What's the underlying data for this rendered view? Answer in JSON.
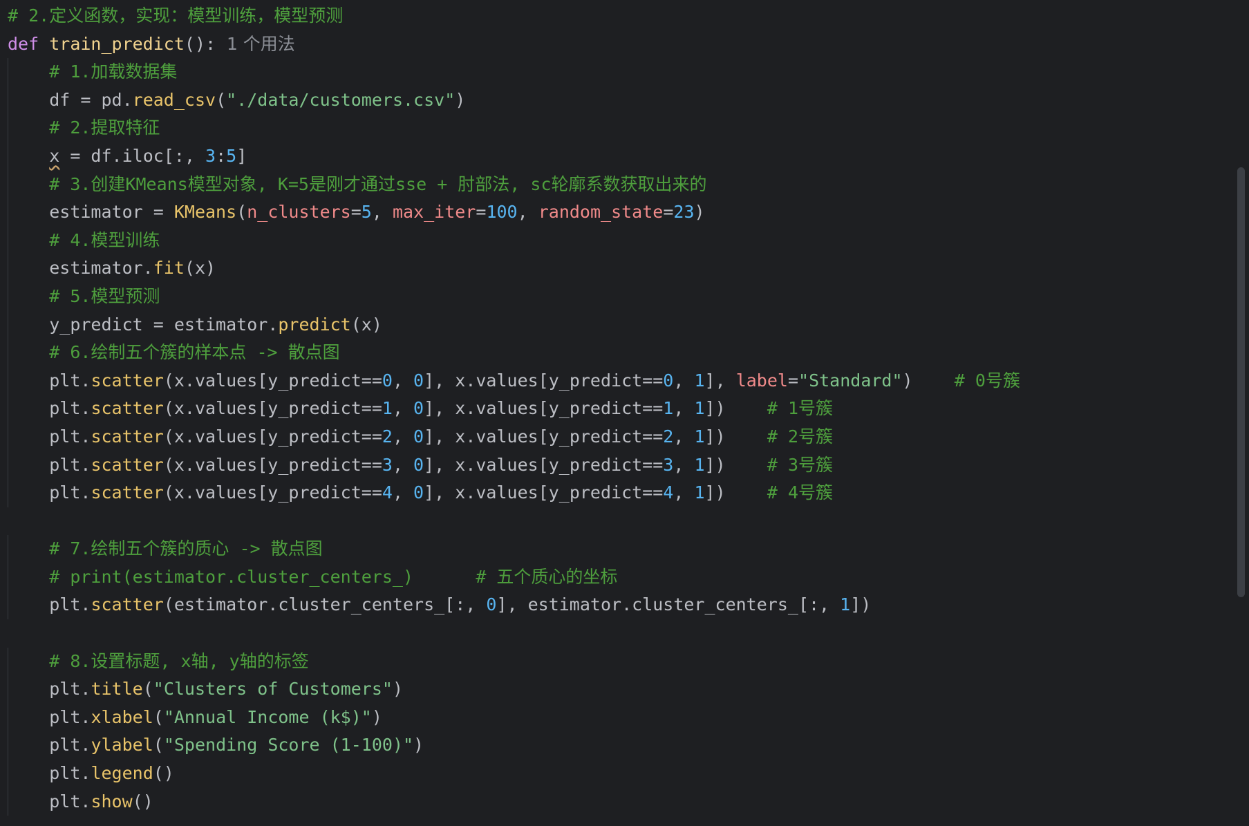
{
  "colors": {
    "background": "#1e1f22",
    "plain": "#bcbec4",
    "keyword": "#cf8ee8",
    "function_def": "#f0d28f",
    "call": "#e9c46a",
    "string": "#7fc28a",
    "number": "#58b4f0",
    "comment": "#4e9f3d",
    "param": "#f08a8a",
    "hint": "#8c8f96",
    "indent_guide": "#393b40",
    "scrollbar_thumb": "#3c3f45"
  },
  "lines": [
    {
      "indent": 0,
      "tokens": [
        {
          "t": "# 2.定义函数，实现：模型训练，模型预测",
          "c": "comment"
        }
      ]
    },
    {
      "indent": 0,
      "tokens": [
        {
          "t": "def",
          "c": "keyword"
        },
        {
          "t": " ",
          "c": "plain"
        },
        {
          "t": "train_predict",
          "c": "function_def"
        },
        {
          "t": "():",
          "c": "plain"
        },
        {
          "t": "  1 个用法",
          "c": "hint",
          "f": "sans"
        }
      ]
    },
    {
      "indent": 4,
      "tokens": [
        {
          "t": "# 1.加载数据集",
          "c": "comment"
        }
      ]
    },
    {
      "indent": 4,
      "tokens": [
        {
          "t": "df = pd.",
          "c": "plain"
        },
        {
          "t": "read_csv",
          "c": "call"
        },
        {
          "t": "(",
          "c": "plain"
        },
        {
          "t": "\"./data/customers.csv\"",
          "c": "string"
        },
        {
          "t": ")",
          "c": "plain"
        }
      ]
    },
    {
      "indent": 4,
      "tokens": [
        {
          "t": "# 2.提取特征",
          "c": "comment"
        }
      ]
    },
    {
      "indent": 4,
      "tokens": [
        {
          "t": "x",
          "c": "plain",
          "sq": true
        },
        {
          "t": " = df.iloc[:, ",
          "c": "plain"
        },
        {
          "t": "3",
          "c": "number"
        },
        {
          "t": ":",
          "c": "plain"
        },
        {
          "t": "5",
          "c": "number"
        },
        {
          "t": "]",
          "c": "plain"
        }
      ]
    },
    {
      "indent": 4,
      "tokens": [
        {
          "t": "# 3.创建KMeans模型对象, K=5是刚才通过sse + 肘部法, sc轮廓系数获取出来的",
          "c": "comment"
        }
      ]
    },
    {
      "indent": 4,
      "tokens": [
        {
          "t": "estimator = ",
          "c": "plain"
        },
        {
          "t": "KMeans",
          "c": "call"
        },
        {
          "t": "(",
          "c": "plain"
        },
        {
          "t": "n_clusters",
          "c": "param"
        },
        {
          "t": "=",
          "c": "plain"
        },
        {
          "t": "5",
          "c": "number"
        },
        {
          "t": ", ",
          "c": "plain"
        },
        {
          "t": "max_iter",
          "c": "param"
        },
        {
          "t": "=",
          "c": "plain"
        },
        {
          "t": "100",
          "c": "number"
        },
        {
          "t": ", ",
          "c": "plain"
        },
        {
          "t": "random_state",
          "c": "param"
        },
        {
          "t": "=",
          "c": "plain"
        },
        {
          "t": "23",
          "c": "number"
        },
        {
          "t": ")",
          "c": "plain"
        }
      ]
    },
    {
      "indent": 4,
      "tokens": [
        {
          "t": "# 4.模型训练",
          "c": "comment"
        }
      ]
    },
    {
      "indent": 4,
      "tokens": [
        {
          "t": "estimator.",
          "c": "plain"
        },
        {
          "t": "fit",
          "c": "call"
        },
        {
          "t": "(x)",
          "c": "plain"
        }
      ]
    },
    {
      "indent": 4,
      "tokens": [
        {
          "t": "# 5.模型预测",
          "c": "comment"
        }
      ]
    },
    {
      "indent": 4,
      "tokens": [
        {
          "t": "y_predict = estimator.",
          "c": "plain"
        },
        {
          "t": "predict",
          "c": "call"
        },
        {
          "t": "(x)",
          "c": "plain"
        }
      ]
    },
    {
      "indent": 4,
      "tokens": [
        {
          "t": "# 6.绘制五个簇的样本点 -> 散点图",
          "c": "comment"
        }
      ]
    },
    {
      "indent": 4,
      "tokens": [
        {
          "t": "plt.",
          "c": "plain"
        },
        {
          "t": "scatter",
          "c": "call"
        },
        {
          "t": "(x.values[y_predict==",
          "c": "plain"
        },
        {
          "t": "0",
          "c": "number"
        },
        {
          "t": ", ",
          "c": "plain"
        },
        {
          "t": "0",
          "c": "number"
        },
        {
          "t": "], x.values[y_predict==",
          "c": "plain"
        },
        {
          "t": "0",
          "c": "number"
        },
        {
          "t": ", ",
          "c": "plain"
        },
        {
          "t": "1",
          "c": "number"
        },
        {
          "t": "], ",
          "c": "plain"
        },
        {
          "t": "label",
          "c": "param"
        },
        {
          "t": "=",
          "c": "plain"
        },
        {
          "t": "\"Standard\"",
          "c": "string"
        },
        {
          "t": ")    ",
          "c": "plain"
        },
        {
          "t": "# 0号簇",
          "c": "comment"
        }
      ]
    },
    {
      "indent": 4,
      "tokens": [
        {
          "t": "plt.",
          "c": "plain"
        },
        {
          "t": "scatter",
          "c": "call"
        },
        {
          "t": "(x.values[y_predict==",
          "c": "plain"
        },
        {
          "t": "1",
          "c": "number"
        },
        {
          "t": ", ",
          "c": "plain"
        },
        {
          "t": "0",
          "c": "number"
        },
        {
          "t": "], x.values[y_predict==",
          "c": "plain"
        },
        {
          "t": "1",
          "c": "number"
        },
        {
          "t": ", ",
          "c": "plain"
        },
        {
          "t": "1",
          "c": "number"
        },
        {
          "t": "])    ",
          "c": "plain"
        },
        {
          "t": "# 1号簇",
          "c": "comment"
        }
      ]
    },
    {
      "indent": 4,
      "tokens": [
        {
          "t": "plt.",
          "c": "plain"
        },
        {
          "t": "scatter",
          "c": "call"
        },
        {
          "t": "(x.values[y_predict==",
          "c": "plain"
        },
        {
          "t": "2",
          "c": "number"
        },
        {
          "t": ", ",
          "c": "plain"
        },
        {
          "t": "0",
          "c": "number"
        },
        {
          "t": "], x.values[y_predict==",
          "c": "plain"
        },
        {
          "t": "2",
          "c": "number"
        },
        {
          "t": ", ",
          "c": "plain"
        },
        {
          "t": "1",
          "c": "number"
        },
        {
          "t": "])    ",
          "c": "plain"
        },
        {
          "t": "# 2号簇",
          "c": "comment"
        }
      ]
    },
    {
      "indent": 4,
      "tokens": [
        {
          "t": "plt.",
          "c": "plain"
        },
        {
          "t": "scatter",
          "c": "call"
        },
        {
          "t": "(x.values[y_predict==",
          "c": "plain"
        },
        {
          "t": "3",
          "c": "number"
        },
        {
          "t": ", ",
          "c": "plain"
        },
        {
          "t": "0",
          "c": "number"
        },
        {
          "t": "], x.values[y_predict==",
          "c": "plain"
        },
        {
          "t": "3",
          "c": "number"
        },
        {
          "t": ", ",
          "c": "plain"
        },
        {
          "t": "1",
          "c": "number"
        },
        {
          "t": "])    ",
          "c": "plain"
        },
        {
          "t": "# 3号簇",
          "c": "comment"
        }
      ]
    },
    {
      "indent": 4,
      "tokens": [
        {
          "t": "plt.",
          "c": "plain"
        },
        {
          "t": "scatter",
          "c": "call"
        },
        {
          "t": "(x.values[y_predict==",
          "c": "plain"
        },
        {
          "t": "4",
          "c": "number"
        },
        {
          "t": ", ",
          "c": "plain"
        },
        {
          "t": "0",
          "c": "number"
        },
        {
          "t": "], x.values[y_predict==",
          "c": "plain"
        },
        {
          "t": "4",
          "c": "number"
        },
        {
          "t": ", ",
          "c": "plain"
        },
        {
          "t": "1",
          "c": "number"
        },
        {
          "t": "])    ",
          "c": "plain"
        },
        {
          "t": "# 4号簇",
          "c": "comment"
        }
      ]
    },
    {
      "indent": 0,
      "tokens": []
    },
    {
      "indent": 4,
      "tokens": [
        {
          "t": "# 7.绘制五个簇的质心 -> 散点图",
          "c": "comment"
        }
      ]
    },
    {
      "indent": 4,
      "tokens": [
        {
          "t": "# print(estimator.cluster_centers_)      # 五个质心的坐标",
          "c": "comment"
        }
      ]
    },
    {
      "indent": 4,
      "tokens": [
        {
          "t": "plt.",
          "c": "plain"
        },
        {
          "t": "scatter",
          "c": "call"
        },
        {
          "t": "(estimator.cluster_centers_[:, ",
          "c": "plain"
        },
        {
          "t": "0",
          "c": "number"
        },
        {
          "t": "], estimator.cluster_centers_[:, ",
          "c": "plain"
        },
        {
          "t": "1",
          "c": "number"
        },
        {
          "t": "])",
          "c": "plain"
        }
      ]
    },
    {
      "indent": 0,
      "tokens": []
    },
    {
      "indent": 4,
      "tokens": [
        {
          "t": "# 8.设置标题, x轴, y轴的标签",
          "c": "comment"
        }
      ]
    },
    {
      "indent": 4,
      "tokens": [
        {
          "t": "plt.",
          "c": "plain"
        },
        {
          "t": "title",
          "c": "call"
        },
        {
          "t": "(",
          "c": "plain"
        },
        {
          "t": "\"Clusters of Customers\"",
          "c": "string"
        },
        {
          "t": ")",
          "c": "plain"
        }
      ]
    },
    {
      "indent": 4,
      "tokens": [
        {
          "t": "plt.",
          "c": "plain"
        },
        {
          "t": "xlabel",
          "c": "call"
        },
        {
          "t": "(",
          "c": "plain"
        },
        {
          "t": "\"Annual Income (k$)\"",
          "c": "string"
        },
        {
          "t": ")",
          "c": "plain"
        }
      ]
    },
    {
      "indent": 4,
      "tokens": [
        {
          "t": "plt.",
          "c": "plain"
        },
        {
          "t": "ylabel",
          "c": "call"
        },
        {
          "t": "(",
          "c": "plain"
        },
        {
          "t": "\"Spending Score (1-100)\"",
          "c": "string"
        },
        {
          "t": ")",
          "c": "plain"
        }
      ]
    },
    {
      "indent": 4,
      "tokens": [
        {
          "t": "plt.",
          "c": "plain"
        },
        {
          "t": "legend",
          "c": "call"
        },
        {
          "t": "()",
          "c": "plain"
        }
      ]
    },
    {
      "indent": 4,
      "tokens": [
        {
          "t": "plt.",
          "c": "plain"
        },
        {
          "t": "show",
          "c": "call"
        },
        {
          "t": "()",
          "c": "plain"
        }
      ]
    }
  ]
}
